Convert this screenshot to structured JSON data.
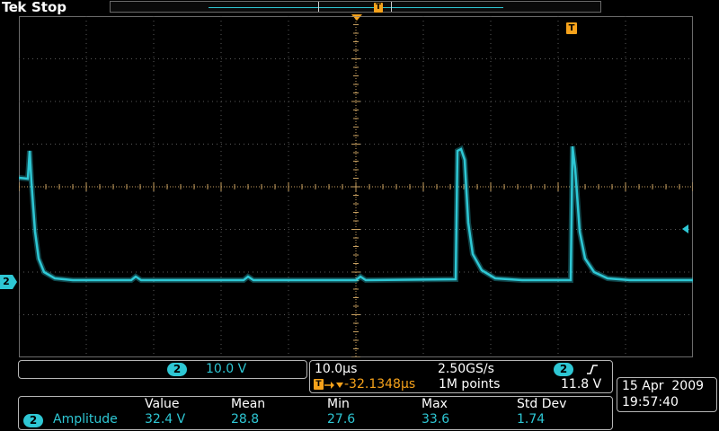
{
  "header": {
    "brand": "Tek",
    "status": "Stop"
  },
  "trigger_marker_label": "T",
  "channel_marker_label": "2",
  "channel_panel": {
    "channel": "2",
    "scale": "10.0 V"
  },
  "timebase_panel": {
    "horizontal_scale": "10.0µs",
    "sample_rate": "2.50GS/s",
    "trigger_channel": "2",
    "trigger_slope_icon": "rising-edge-icon",
    "trigger_icon": "T",
    "delay": "-32.1348µs",
    "record_length": "1M points",
    "trigger_level": "11.8 V"
  },
  "datetime": {
    "date": "15 Apr  2009",
    "time": "19:57:40"
  },
  "measurements": {
    "headers": [
      "Value",
      "Mean",
      "Min",
      "Max",
      "Std Dev"
    ],
    "rows": [
      {
        "channel": "2",
        "name": "Amplitude",
        "values": [
          "32.4 V",
          "28.8",
          "27.6",
          "33.6",
          "1.74"
        ]
      }
    ]
  },
  "colors": {
    "channel2": "#2ec7d4",
    "trigger": "#f6a21b",
    "graticule_axis": "#c8a060",
    "grid_dot": "#5a5a5a"
  }
}
